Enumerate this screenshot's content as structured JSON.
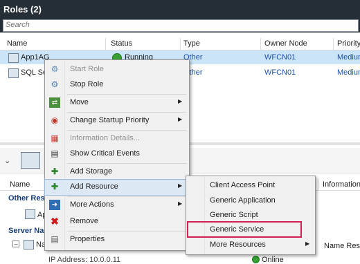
{
  "header": {
    "title": "Roles (2)",
    "search_placeholder": "Search"
  },
  "columns": [
    "Name",
    "Status",
    "Type",
    "Owner Node",
    "Priority"
  ],
  "rows": [
    {
      "name": "App1AG",
      "status": "Running",
      "type": "Other",
      "owner": "WFCN01",
      "priority": "Medium"
    },
    {
      "name": "SQL Se",
      "status": "",
      "type": "Other",
      "owner": "WFCN01",
      "priority": "Medium"
    }
  ],
  "lower": {
    "col_name": "Name",
    "col_information": "Information",
    "section_other": "Other Res",
    "row_app": "Ap",
    "section_server": "Server Na",
    "row_na": "Na",
    "name_res": "Name Res",
    "ip_row": "IP Address: 10.0.0.11",
    "ip_status": "Online"
  },
  "context_menu": {
    "items": [
      {
        "label": "Start Role",
        "icon": "start-role-icon"
      },
      {
        "label": "Stop Role",
        "icon": "stop-role-icon"
      },
      {
        "label": "Move",
        "icon": "move-icon"
      },
      {
        "label": "Change Startup Priority",
        "icon": "priority-icon"
      },
      {
        "label": "Information Details...",
        "icon": "information-icon"
      },
      {
        "label": "Show Critical Events",
        "icon": "critical-events-icon"
      },
      {
        "label": "Add Storage",
        "icon": "add-storage-icon"
      },
      {
        "label": "Add Resource",
        "icon": "add-resource-icon"
      },
      {
        "label": "More Actions",
        "icon": "more-actions-icon"
      },
      {
        "label": "Remove",
        "icon": "remove-icon"
      },
      {
        "label": "Properties",
        "icon": "properties-icon"
      }
    ]
  },
  "submenu": {
    "items": [
      "Client Access Point",
      "Generic Application",
      "Generic Script",
      "Generic Service",
      "More Resources"
    ],
    "highlighted": "Generic Service"
  },
  "colors": {
    "header_bg": "#252d36",
    "selected_row": "#cce4f7",
    "highlight_border": "#d21f55",
    "status_green": "#39a036"
  }
}
